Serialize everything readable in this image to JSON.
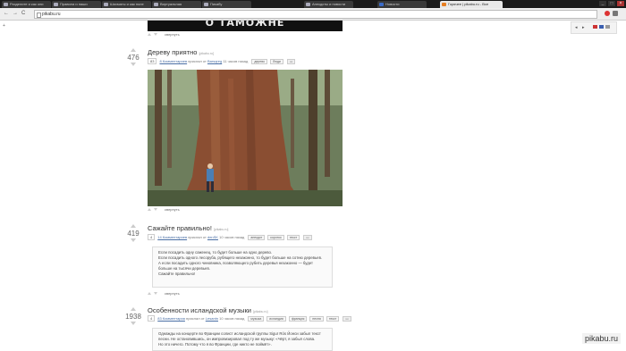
{
  "browser": {
    "tabs": [
      {
        "label": "Разделите и как они"
      },
      {
        "label": "Правила и наши"
      },
      {
        "label": "Шахматы и как поле"
      },
      {
        "label": "Виртуальная"
      },
      {
        "label": "Пикабу"
      },
      {
        "label": "Анекдоты и новости"
      },
      {
        "label": "Новости"
      },
      {
        "label": "Горячее | pikabu.ru - Все"
      }
    ],
    "url": "pikabu.ru",
    "nav": {
      "back": "←",
      "forward": "→",
      "reload": "C"
    }
  },
  "page": {
    "hint": "+",
    "sidebox": {
      "prev": "◂",
      "next": "▸"
    },
    "banner_text": "О ТАМОЖНЕ",
    "collapse_label": "свернуть",
    "posts": [
      {
        "score": "476",
        "title": "Дереву приятно",
        "source": "[pikabu.ru]",
        "comments_count": "83",
        "comments_label": "8 Комментариев",
        "added_by": "прислал от",
        "author": "Barsqreg",
        "time": "11 часов назад",
        "tags": [
          "дерево",
          "Люди"
        ]
      },
      {
        "score": "419",
        "title": "Сажайте правильно!",
        "source": "[pikabu.ru]",
        "comments_count": "4",
        "comments_label": "14 Комментариев",
        "added_by": "прислал от",
        "author": "denSK",
        "time": "10 часов назад",
        "tags": [
          "анекдот",
          "коротко",
          "текст"
        ],
        "text": [
          "Если посадить одну саженец, то будет больше на одно дерево.",
          "Если посадить одного лесоруба, рубящего незаконно, то будет больше на сотню деревьев.",
          "А если посадить одного чиновника, позволяющего рубить деревья незаконно — будет больше на тысячи деревьев.",
          "Сажайте правильно!"
        ]
      },
      {
        "score": "1938",
        "title": "Особенности исландской музыки",
        "source": "[pikabu.ru]",
        "comments_count": "4",
        "comments_label": "83 Комментария",
        "added_by": "прислал от",
        "author": "Lesantn",
        "time": "10 часов назад",
        "tags": [
          "музыка",
          "исландия",
          "франция",
          "песня",
          "текст"
        ],
        "text": [
          "Однажды на концерте во Франции солист исландской группы Sigur Rós Йонси забыл текст песни. Не остановившись, он импровизировал под ту же музыку: «Чёрт, я забыл слова.",
          "Но это ничего. Потому что я во Франции, где никто не поймёт»."
        ]
      }
    ],
    "watermark": "pikabu.ru"
  }
}
